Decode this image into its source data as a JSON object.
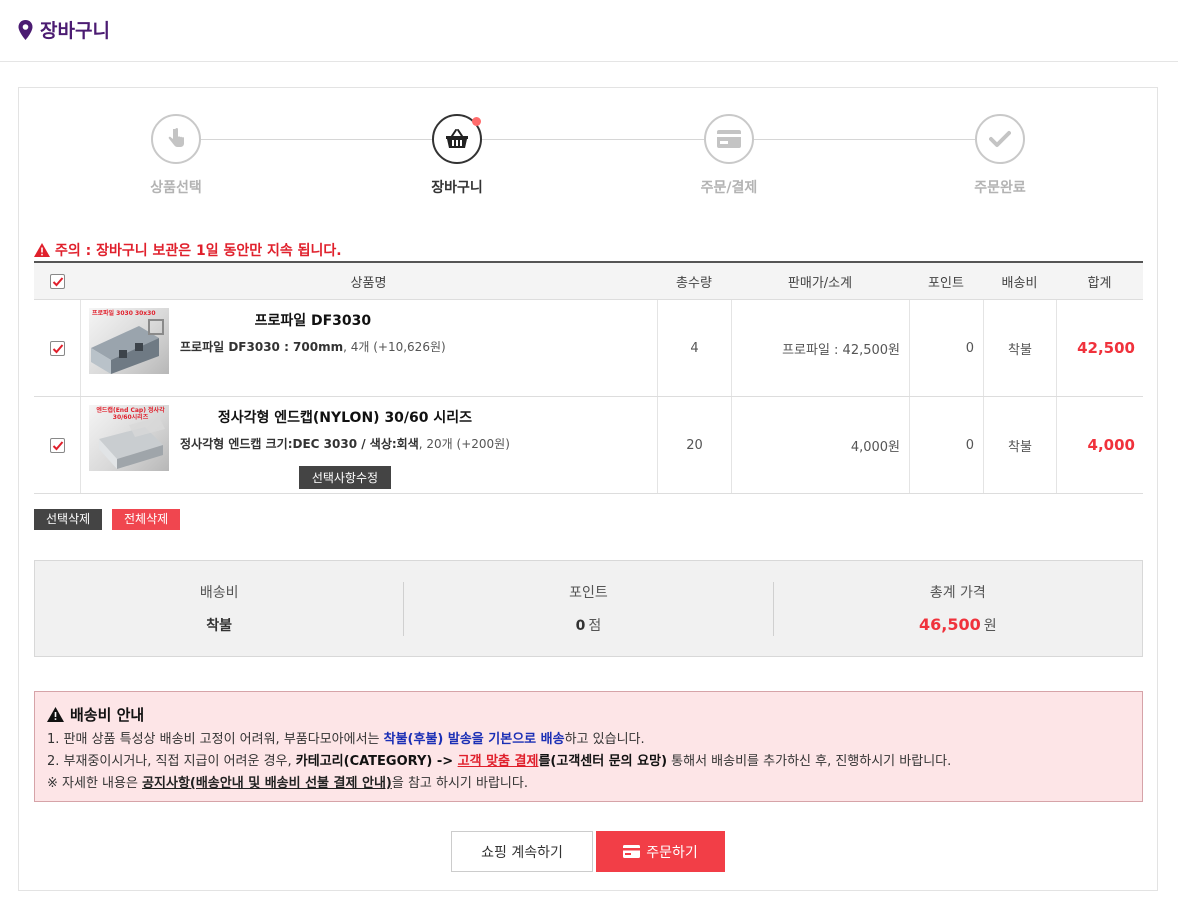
{
  "page": {
    "title": "장바구니"
  },
  "steps": [
    {
      "label": "상품선택",
      "icon": "hand-pointer-icon",
      "active": false
    },
    {
      "label": "장바구니",
      "icon": "basket-icon",
      "active": true
    },
    {
      "label": "주문/결제",
      "icon": "credit-card-icon",
      "active": false
    },
    {
      "label": "주문완료",
      "icon": "check-icon",
      "active": false
    }
  ],
  "notice": "주의 : 장바구니 보관은 1일 동안만 지속 됩니다.",
  "table": {
    "headers": {
      "name": "상품명",
      "qty": "총수량",
      "price": "판매가/소계",
      "point": "포인트",
      "shipping": "배송비",
      "total": "합계"
    },
    "rows": [
      {
        "checked": true,
        "thumb_text": "프로파일 3030 30x30",
        "title": "프로파일 DF3030",
        "option_bold": "프로파일 DF3030 : 700mm",
        "option_rest": ", 4개 (+10,626원)",
        "qty": "4",
        "price": "프로파일 : 42,500원",
        "point": "0",
        "shipping": "착불",
        "total": "42,500"
      },
      {
        "checked": true,
        "thumb_text": "엔드캡(End Cap) 정사각 30/60시리즈",
        "title": "정사각형 엔드캡(NYLON) 30/60 시리즈",
        "option_bold": "정사각형 엔드캡 크기:DEC 3030 / 색상:회색",
        "option_rest": ", 20개 (+200원)",
        "edit_label": "선택사항수정",
        "qty": "20",
        "price": "4,000원",
        "point": "0",
        "shipping": "착불",
        "total": "4,000"
      }
    ]
  },
  "buttons": {
    "delete_selected": "선택삭제",
    "delete_all": "전체삭제",
    "continue_shopping": "쇼핑 계속하기",
    "order": "주문하기"
  },
  "summary": {
    "shipping_label": "배송비",
    "shipping_value": "착불",
    "point_label": "포인트",
    "point_value": "0",
    "point_unit": "점",
    "total_label": "총계 가격",
    "total_value": "46,500",
    "total_unit": "원"
  },
  "shipping_info": {
    "heading": "배송비 안내",
    "line1_a": "1. 판매 상품 특성상 배송비 고정이 어려워, 부품다모아에서는 ",
    "line1_b": "착불(후불) 발송을 기본으로 배송",
    "line1_c": "하고 있습니다.",
    "line2_a": "2. 부재중이시거나, 직접 지급이 어려운 경우, ",
    "line2_b": "카테고리(CATEGORY) -> ",
    "line2_c": "고객 맞춤 결제",
    "line2_d": "를(고객센터 문의 요망)",
    "line2_e": " 통해서 배송비를 추가하신 후, 진행하시기 바랍니다.",
    "line3_a": "※ 자세한 내용은 ",
    "line3_b": "공지사항(배송안내 및 배송비 선불 결제 안내)",
    "line3_c": "을 참고 하시기 바랍니다."
  },
  "colors": {
    "brand_purple": "#4b1b72",
    "accent_red": "#f0323c",
    "dark_button": "#444444"
  }
}
